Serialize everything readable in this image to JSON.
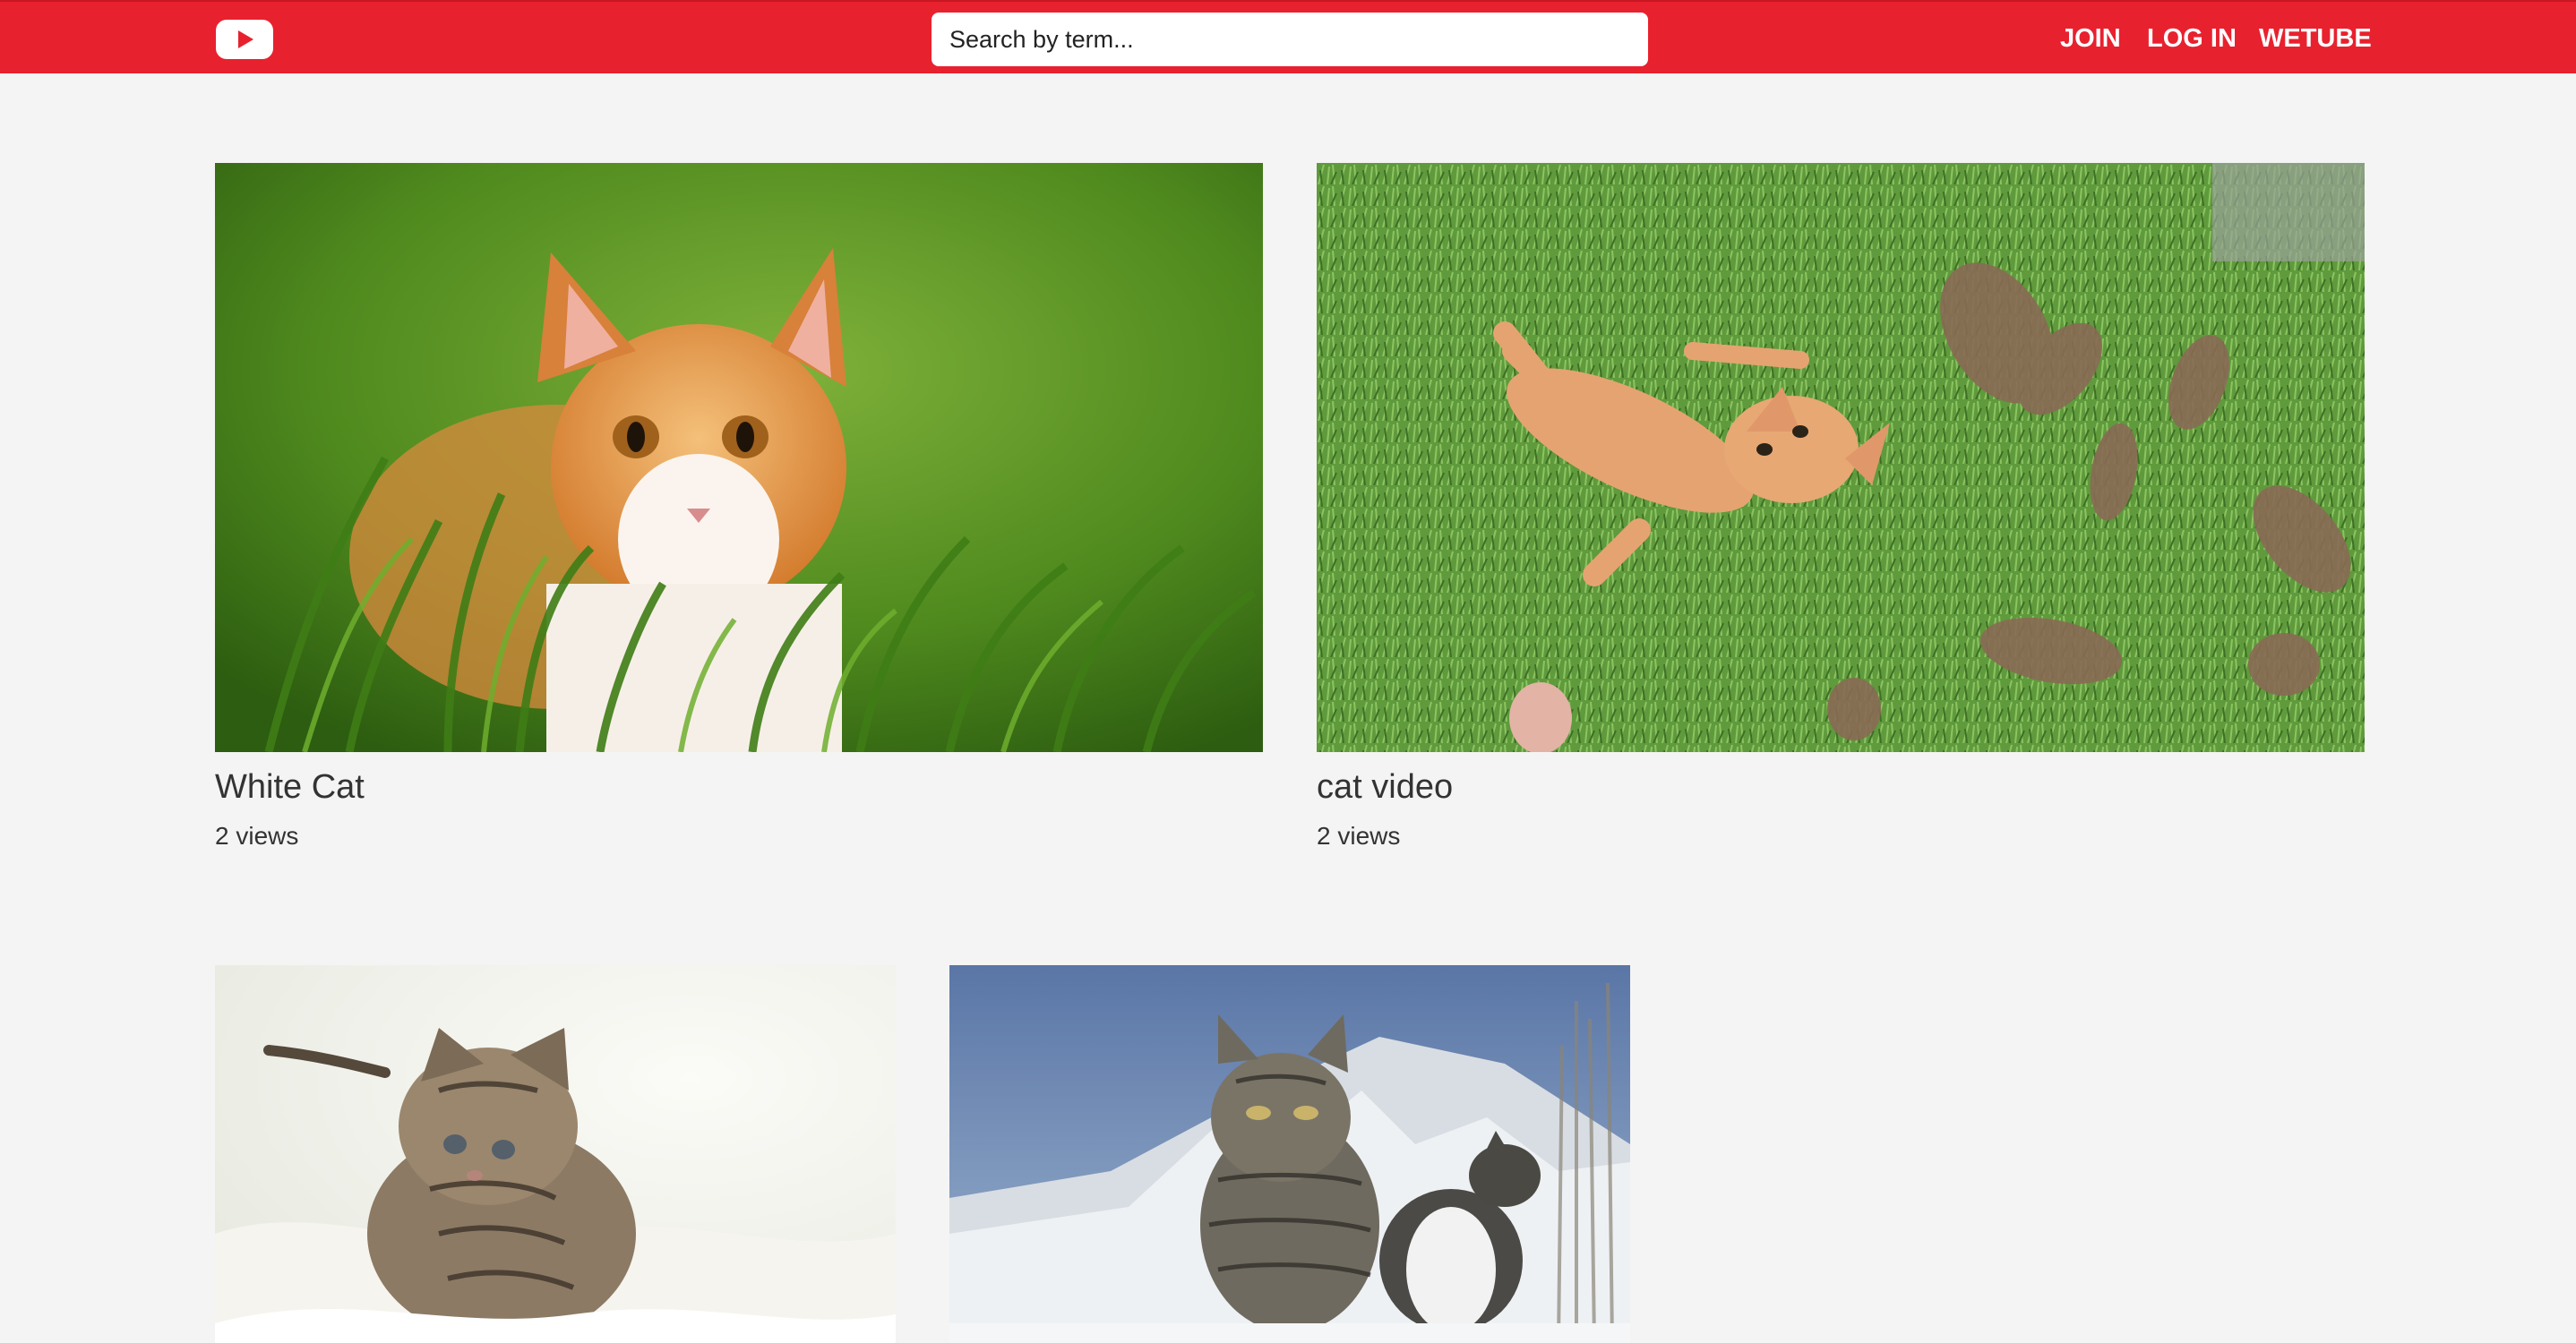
{
  "header": {
    "logo_icon": "youtube-play-icon",
    "search": {
      "placeholder": "Search by term...",
      "value": ""
    },
    "nav": {
      "join": "JOIN",
      "login": "LOG IN",
      "home": "WETUBE"
    },
    "brand_color": "#e8212e"
  },
  "videos": [
    {
      "title": "White Cat",
      "views": "2 views",
      "thumbnail": "orange-white-kitten-in-grass"
    },
    {
      "title": "cat video",
      "views": "2 views",
      "thumbnail": "kitten-rolling-on-grass"
    },
    {
      "title": "",
      "views": "",
      "thumbnail": "tabby-kitten-on-white-fur"
    },
    {
      "title": "",
      "views": "",
      "thumbnail": "tabby-cats-in-snow-mountains"
    }
  ]
}
